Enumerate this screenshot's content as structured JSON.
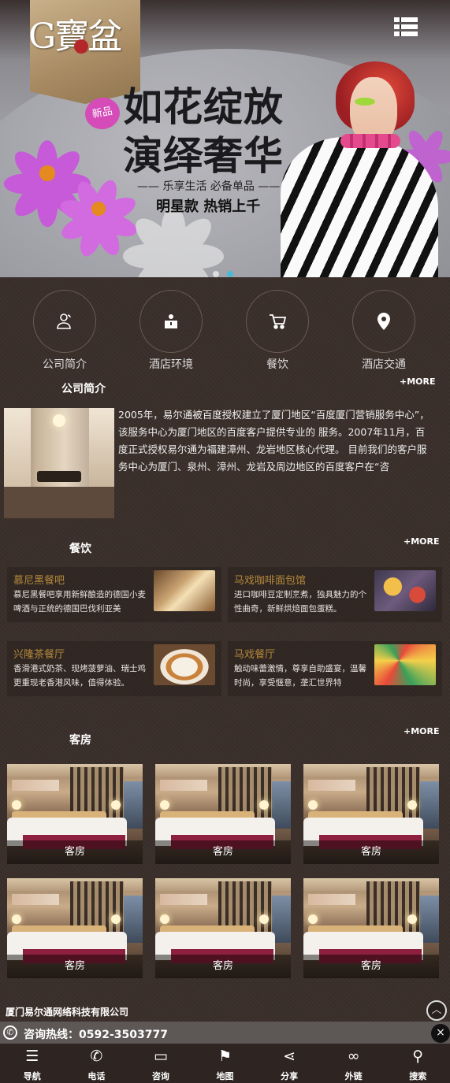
{
  "header": {
    "logo_text": "G寶盆",
    "menu_icon": "menu-list-icon"
  },
  "banner": {
    "badge": "新品",
    "line1": "如花绽放",
    "line2": "演绎奢华",
    "sub": "—— 乐享生活 必备单品 ——",
    "hot": "明星款 热销上千",
    "slides": 2,
    "active_slide": 2,
    "active_dot_color": "#47b8d8"
  },
  "nav": [
    {
      "label": "公司简介",
      "icon": "users-icon"
    },
    {
      "label": "酒店环境",
      "icon": "hotel-icon"
    },
    {
      "label": "餐饮",
      "icon": "cart-icon"
    },
    {
      "label": "酒店交通",
      "icon": "location-icon"
    }
  ],
  "about": {
    "title": "公司简介",
    "more": "+MORE",
    "text": "2005年，易尔通被百度授权建立了厦门地区“百度厦门营销服务中心”，该服务中心为厦门地区的百度客户提供专业的 服务。2007年11月，百度正式授权易尔通为福建漳州、龙岩地区核心代理。 目前我们的客户服务中心为厦门、泉州、漳州、龙岩及周边地区的百度客户在“咨"
  },
  "catering": {
    "title": "餐饮",
    "more": "+MORE",
    "items": [
      {
        "name": "慕尼黑餐吧",
        "desc": "慕尼黑餐吧享用新鲜酿造的德国小麦啤酒与正统的德国巴伐利亚美"
      },
      {
        "name": "马戏咖啡面包馆",
        "desc": "进口咖啡豆定制烹煮，独具魅力的个性曲奇，新鲜烘焙面包蛋糕。"
      },
      {
        "name": "兴隆茶餐厅",
        "desc": "香滑港式奶茶、现烤菠萝油、瑞士鸡更重现老香港风味，值得体验。"
      },
      {
        "name": "马戏餐厅",
        "desc": "触动味蕾激情，尊享自助盛宴，温馨时尚，享受惬意，垄汇世界特"
      }
    ]
  },
  "rooms": {
    "title": "客房",
    "more": "+MORE",
    "items": [
      {
        "label": "客房"
      },
      {
        "label": "客房"
      },
      {
        "label": "客房"
      },
      {
        "label": "客房"
      },
      {
        "label": "客房"
      },
      {
        "label": "客房"
      }
    ]
  },
  "footer": {
    "company": "厦门易尔通网络科技有限公司",
    "hotline": "咨询热线：0592-3503777",
    "close": "×",
    "totop": "︿"
  },
  "bottom_nav": [
    {
      "label": "导航",
      "icon": "menu-icon",
      "glyph": "☰"
    },
    {
      "label": "电话",
      "icon": "phone-icon",
      "glyph": "✆"
    },
    {
      "label": "咨询",
      "icon": "chat-icon",
      "glyph": "▭"
    },
    {
      "label": "地图",
      "icon": "map-icon",
      "glyph": "⚑"
    },
    {
      "label": "分享",
      "icon": "share-icon",
      "glyph": "⋖"
    },
    {
      "label": "外链",
      "icon": "link-icon",
      "glyph": "∞"
    },
    {
      "label": "搜索",
      "icon": "search-icon",
      "glyph": "⚲"
    }
  ]
}
